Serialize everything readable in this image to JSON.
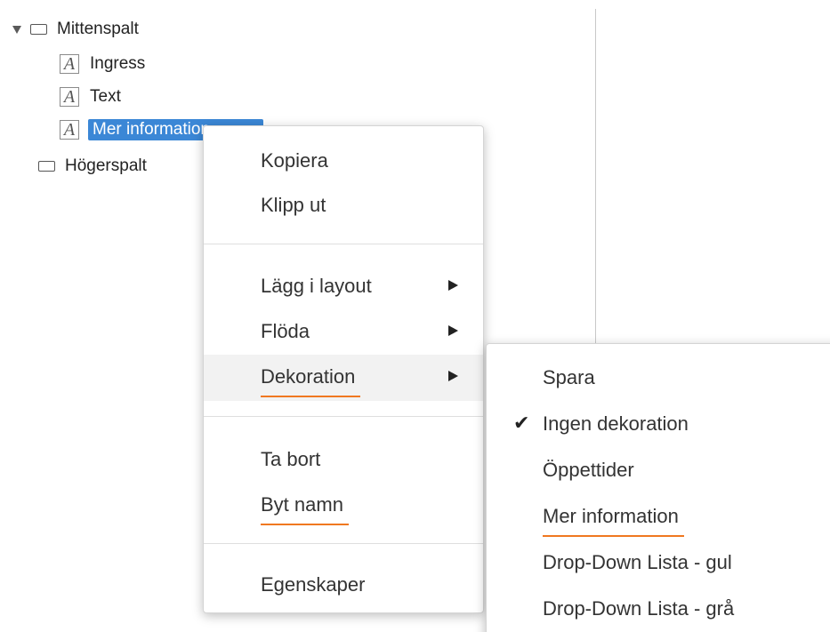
{
  "tree": {
    "root": {
      "label": "Mittenspalt",
      "icon": "layout-box-icon",
      "expanded": true
    },
    "children": [
      {
        "label": "Ingress",
        "icon": "text-a-icon"
      },
      {
        "label": "Text",
        "icon": "text-a-icon"
      },
      {
        "label": "Mer information",
        "icon": "text-a-icon",
        "selected": true
      }
    ],
    "sibling": {
      "label": "Högerspalt",
      "icon": "layout-box-icon"
    },
    "icon_glyph": "A"
  },
  "context_menu": {
    "items": {
      "copy": "Kopiera",
      "cut": "Klipp ut",
      "add_to_layout": "Lägg i layout",
      "flow": "Flöda",
      "decoration": "Dekoration",
      "delete": "Ta bort",
      "rename": "Byt namn",
      "properties": "Egenskaper"
    }
  },
  "decoration_submenu": {
    "items": {
      "save": "Spara",
      "none": "Ingen dekoration",
      "opening_hours": "Öppettider",
      "more_info": "Mer information",
      "dropdown_yellow": "Drop-Down Lista - gul",
      "dropdown_gray": "Drop-Down Lista - grå"
    },
    "checked": "none",
    "check_glyph": "✔"
  },
  "colors": {
    "selection": "#3b87d6",
    "underline_accent": "#f07820",
    "hover": "#f2f2f2"
  }
}
